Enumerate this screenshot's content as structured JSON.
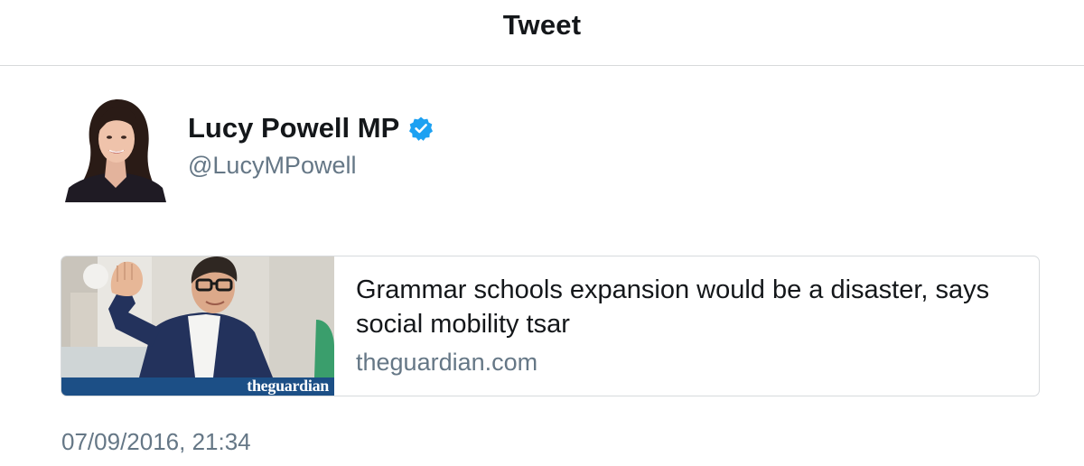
{
  "header": {
    "title": "Tweet"
  },
  "author": {
    "display_name": "Lucy Powell MP",
    "handle": "@LucyMPowell",
    "verified": true,
    "verified_icon": "verified-badge-icon",
    "avatar_icon": "profile-photo"
  },
  "link_card": {
    "title": "Grammar schools expansion would be a disaster, says social mobility tsar",
    "domain": "theguardian.com",
    "image_logo_text": "theguardian"
  },
  "tweet": {
    "timestamp": "07/09/2016, 21:34"
  },
  "colors": {
    "text_primary": "#14171a",
    "text_secondary": "#657786",
    "verified_blue": "#1da1f2",
    "guardian_blue": "#1c4f86",
    "divider": "#d7d9db"
  }
}
